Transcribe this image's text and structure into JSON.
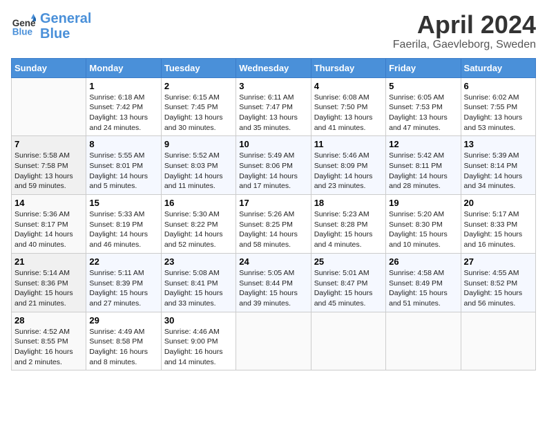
{
  "header": {
    "logo_line1": "General",
    "logo_line2": "Blue",
    "month": "April 2024",
    "location": "Faerila, Gaevleborg, Sweden"
  },
  "weekdays": [
    "Sunday",
    "Monday",
    "Tuesday",
    "Wednesday",
    "Thursday",
    "Friday",
    "Saturday"
  ],
  "weeks": [
    [
      {
        "day": "",
        "info": ""
      },
      {
        "day": "1",
        "info": "Sunrise: 6:18 AM\nSunset: 7:42 PM\nDaylight: 13 hours\nand 24 minutes."
      },
      {
        "day": "2",
        "info": "Sunrise: 6:15 AM\nSunset: 7:45 PM\nDaylight: 13 hours\nand 30 minutes."
      },
      {
        "day": "3",
        "info": "Sunrise: 6:11 AM\nSunset: 7:47 PM\nDaylight: 13 hours\nand 35 minutes."
      },
      {
        "day": "4",
        "info": "Sunrise: 6:08 AM\nSunset: 7:50 PM\nDaylight: 13 hours\nand 41 minutes."
      },
      {
        "day": "5",
        "info": "Sunrise: 6:05 AM\nSunset: 7:53 PM\nDaylight: 13 hours\nand 47 minutes."
      },
      {
        "day": "6",
        "info": "Sunrise: 6:02 AM\nSunset: 7:55 PM\nDaylight: 13 hours\nand 53 minutes."
      }
    ],
    [
      {
        "day": "7",
        "info": "Sunrise: 5:58 AM\nSunset: 7:58 PM\nDaylight: 13 hours\nand 59 minutes."
      },
      {
        "day": "8",
        "info": "Sunrise: 5:55 AM\nSunset: 8:01 PM\nDaylight: 14 hours\nand 5 minutes."
      },
      {
        "day": "9",
        "info": "Sunrise: 5:52 AM\nSunset: 8:03 PM\nDaylight: 14 hours\nand 11 minutes."
      },
      {
        "day": "10",
        "info": "Sunrise: 5:49 AM\nSunset: 8:06 PM\nDaylight: 14 hours\nand 17 minutes."
      },
      {
        "day": "11",
        "info": "Sunrise: 5:46 AM\nSunset: 8:09 PM\nDaylight: 14 hours\nand 23 minutes."
      },
      {
        "day": "12",
        "info": "Sunrise: 5:42 AM\nSunset: 8:11 PM\nDaylight: 14 hours\nand 28 minutes."
      },
      {
        "day": "13",
        "info": "Sunrise: 5:39 AM\nSunset: 8:14 PM\nDaylight: 14 hours\nand 34 minutes."
      }
    ],
    [
      {
        "day": "14",
        "info": "Sunrise: 5:36 AM\nSunset: 8:17 PM\nDaylight: 14 hours\nand 40 minutes."
      },
      {
        "day": "15",
        "info": "Sunrise: 5:33 AM\nSunset: 8:19 PM\nDaylight: 14 hours\nand 46 minutes."
      },
      {
        "day": "16",
        "info": "Sunrise: 5:30 AM\nSunset: 8:22 PM\nDaylight: 14 hours\nand 52 minutes."
      },
      {
        "day": "17",
        "info": "Sunrise: 5:26 AM\nSunset: 8:25 PM\nDaylight: 14 hours\nand 58 minutes."
      },
      {
        "day": "18",
        "info": "Sunrise: 5:23 AM\nSunset: 8:28 PM\nDaylight: 15 hours\nand 4 minutes."
      },
      {
        "day": "19",
        "info": "Sunrise: 5:20 AM\nSunset: 8:30 PM\nDaylight: 15 hours\nand 10 minutes."
      },
      {
        "day": "20",
        "info": "Sunrise: 5:17 AM\nSunset: 8:33 PM\nDaylight: 15 hours\nand 16 minutes."
      }
    ],
    [
      {
        "day": "21",
        "info": "Sunrise: 5:14 AM\nSunset: 8:36 PM\nDaylight: 15 hours\nand 21 minutes."
      },
      {
        "day": "22",
        "info": "Sunrise: 5:11 AM\nSunset: 8:39 PM\nDaylight: 15 hours\nand 27 minutes."
      },
      {
        "day": "23",
        "info": "Sunrise: 5:08 AM\nSunset: 8:41 PM\nDaylight: 15 hours\nand 33 minutes."
      },
      {
        "day": "24",
        "info": "Sunrise: 5:05 AM\nSunset: 8:44 PM\nDaylight: 15 hours\nand 39 minutes."
      },
      {
        "day": "25",
        "info": "Sunrise: 5:01 AM\nSunset: 8:47 PM\nDaylight: 15 hours\nand 45 minutes."
      },
      {
        "day": "26",
        "info": "Sunrise: 4:58 AM\nSunset: 8:49 PM\nDaylight: 15 hours\nand 51 minutes."
      },
      {
        "day": "27",
        "info": "Sunrise: 4:55 AM\nSunset: 8:52 PM\nDaylight: 15 hours\nand 56 minutes."
      }
    ],
    [
      {
        "day": "28",
        "info": "Sunrise: 4:52 AM\nSunset: 8:55 PM\nDaylight: 16 hours\nand 2 minutes."
      },
      {
        "day": "29",
        "info": "Sunrise: 4:49 AM\nSunset: 8:58 PM\nDaylight: 16 hours\nand 8 minutes."
      },
      {
        "day": "30",
        "info": "Sunrise: 4:46 AM\nSunset: 9:00 PM\nDaylight: 16 hours\nand 14 minutes."
      },
      {
        "day": "",
        "info": ""
      },
      {
        "day": "",
        "info": ""
      },
      {
        "day": "",
        "info": ""
      },
      {
        "day": "",
        "info": ""
      }
    ]
  ]
}
